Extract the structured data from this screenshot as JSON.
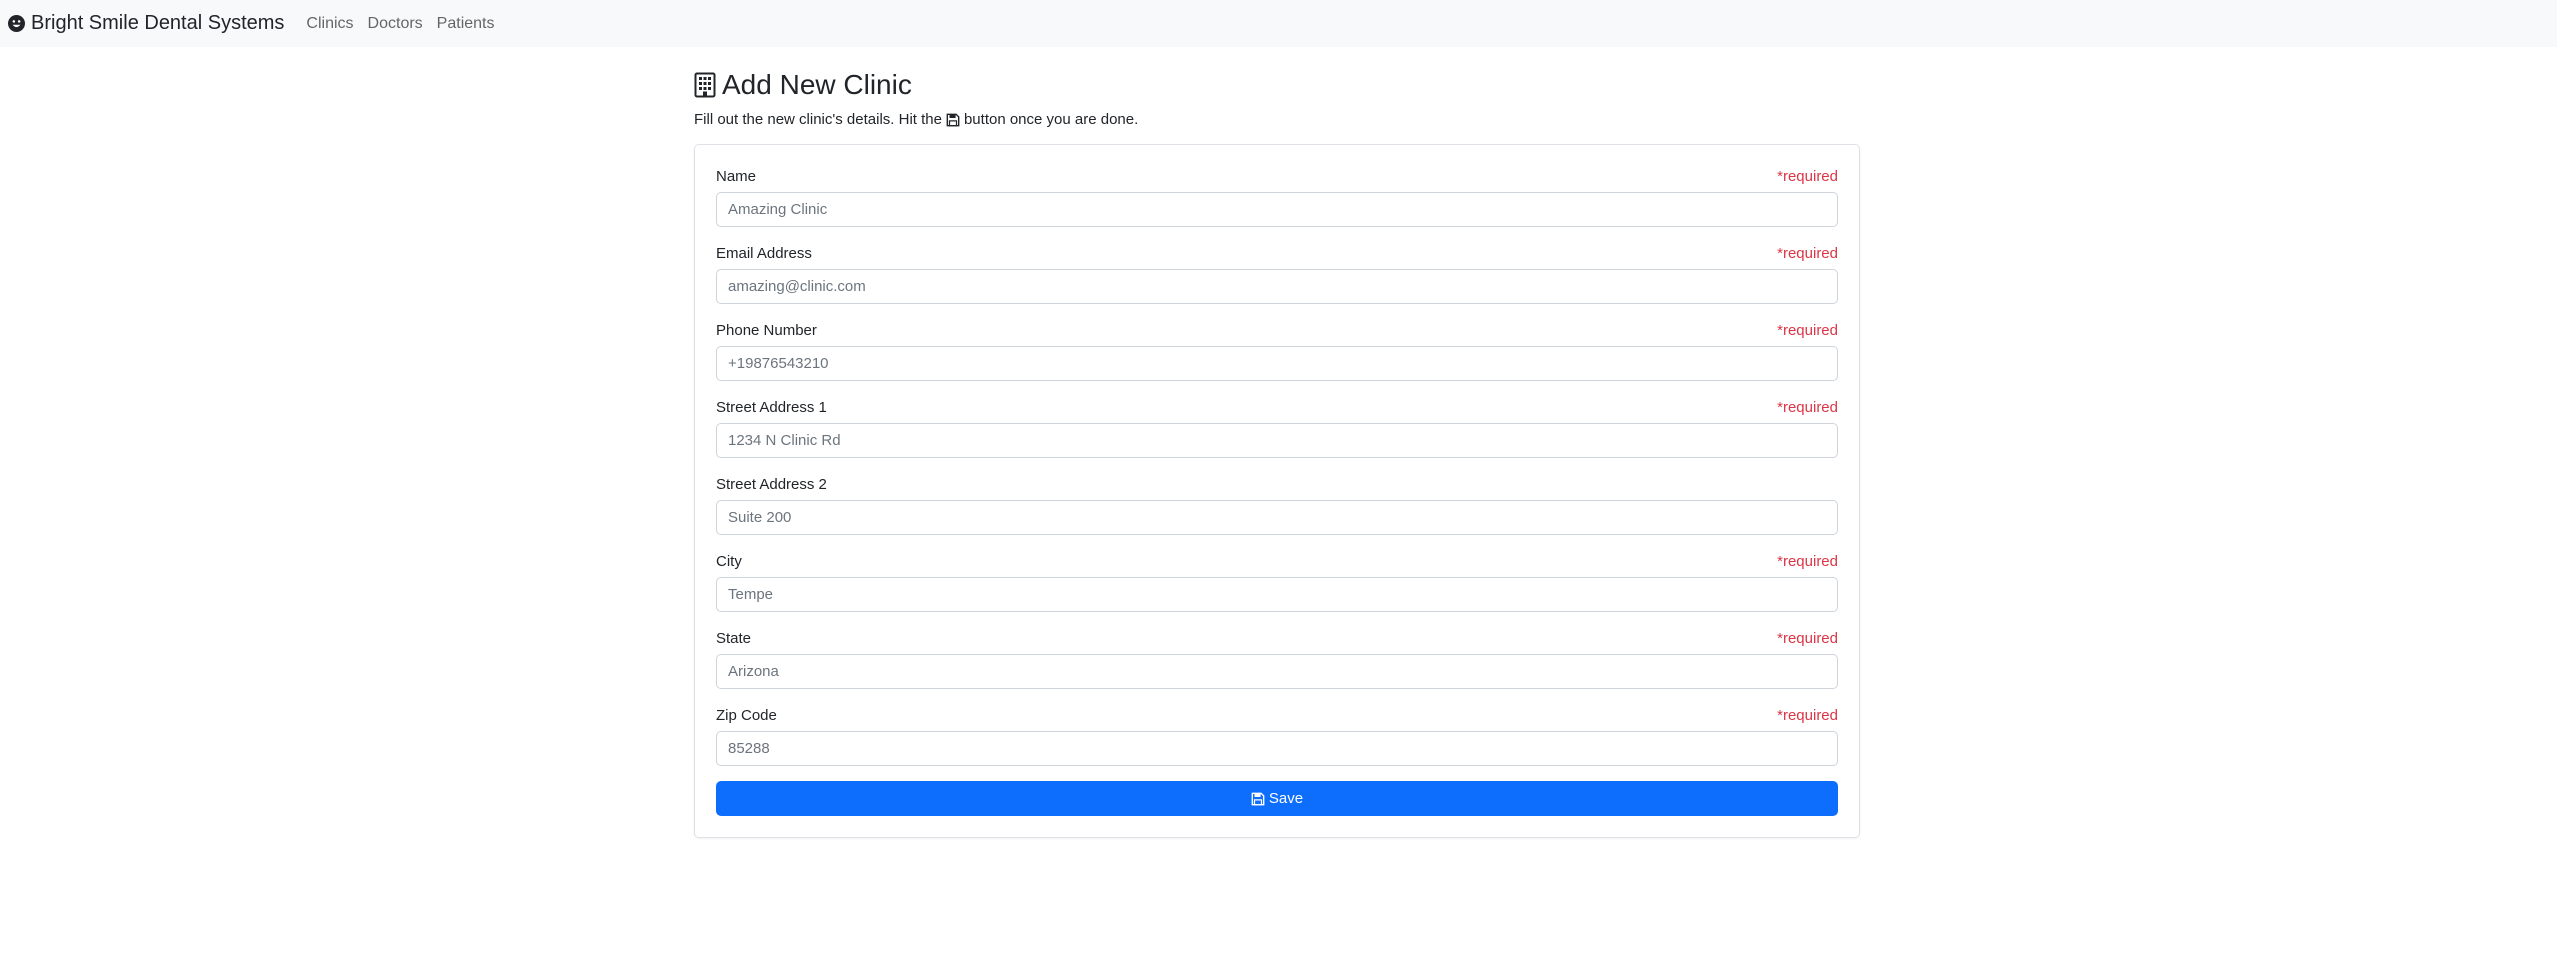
{
  "navbar": {
    "brand_icon": "smile-face-icon",
    "brand": "Bright Smile Dental Systems",
    "links": [
      "Clinics",
      "Doctors",
      "Patients"
    ]
  },
  "header": {
    "title_icon": "building-icon",
    "title": "Add New Clinic",
    "subtitle_before": "Fill out the new clinic's details. Hit the",
    "subtitle_icon": "floppy-disk-icon",
    "subtitle_after": "button once you are done."
  },
  "form": {
    "required_text": "*required",
    "fields": [
      {
        "label": "Name",
        "placeholder": "Amazing Clinic",
        "required": true
      },
      {
        "label": "Email Address",
        "placeholder": "amazing@clinic.com",
        "required": true
      },
      {
        "label": "Phone Number",
        "placeholder": "+19876543210",
        "required": true
      },
      {
        "label": "Street Address 1",
        "placeholder": "1234 N Clinic Rd",
        "required": true
      },
      {
        "label": "Street Address 2",
        "placeholder": "Suite 200",
        "required": false
      },
      {
        "label": "City",
        "placeholder": "Tempe",
        "required": true
      },
      {
        "label": "State",
        "placeholder": "Arizona",
        "required": true
      },
      {
        "label": "Zip Code",
        "placeholder": "85288",
        "required": true
      }
    ],
    "save_icon": "floppy-disk-icon",
    "save_label": "Save"
  },
  "colors": {
    "navbar_bg": "#f8f9fa",
    "primary": "#0d6efd",
    "required": "#dc3545"
  }
}
